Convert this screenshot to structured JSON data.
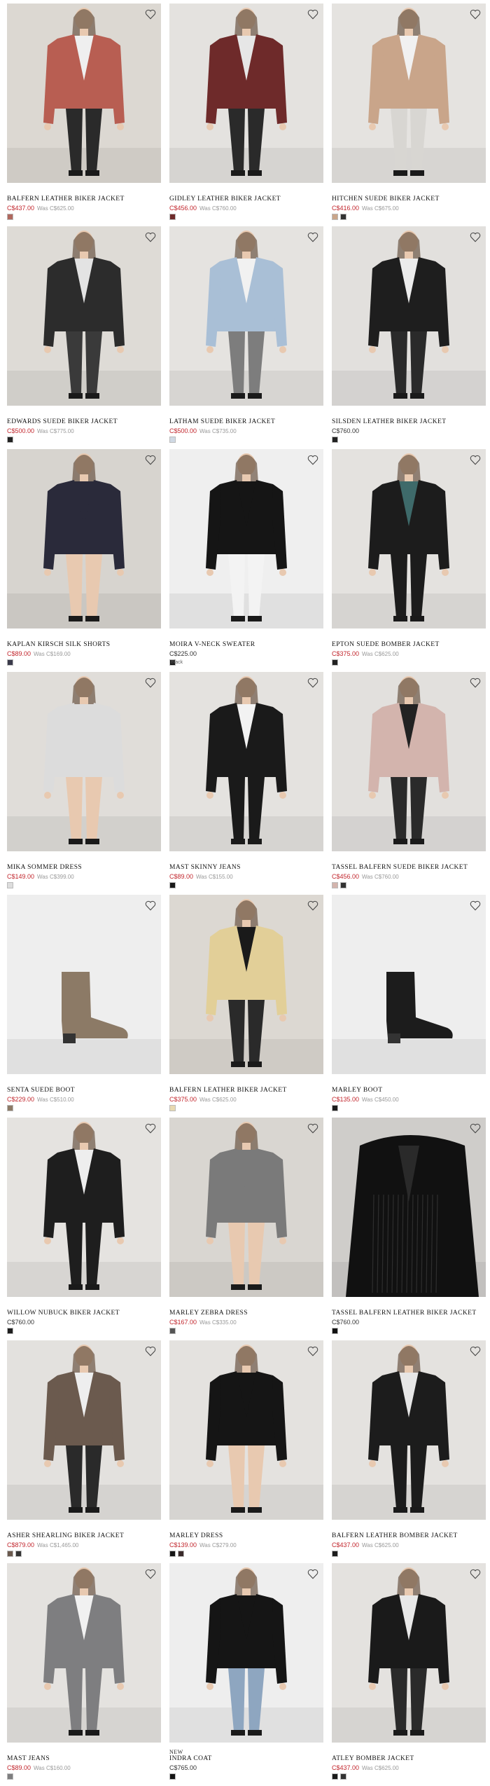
{
  "products": [
    {
      "name": "BALFERN LEATHER BIKER JACKET",
      "price": "C$437.00",
      "was": "Was C$625.00",
      "sale": true,
      "bg": "#dcd8d2",
      "garment": "#b85e52",
      "skin": "#e8c9b0",
      "pants": "#2a2a2a",
      "top": "#efefef",
      "swatches": [
        "#b0685e"
      ]
    },
    {
      "name": "GIDLEY LEATHER BIKER JACKET",
      "price": "C$456.00",
      "was": "Was C$760.00",
      "sale": true,
      "bg": "#e4e2df",
      "garment": "#6e2a2a",
      "skin": "#e8c9b0",
      "pants": "#2a2a2a",
      "top": "#e6e6e6",
      "swatches": [
        "#6e2a2a"
      ]
    },
    {
      "name": "HITCHEN SUEDE BIKER JACKET",
      "price": "C$416.00",
      "was": "Was C$675.00",
      "sale": true,
      "bg": "#e5e3e0",
      "garment": "#c9a58a",
      "skin": "#e8c9b0",
      "pants": "#d8d6d2",
      "top": "#f1f1f1",
      "swatches": [
        "#c9a58a",
        "#333333"
      ]
    },
    {
      "name": "EDWARDS SUEDE BIKER JACKET",
      "price": "C$500.00",
      "was": "Was C$775.00",
      "sale": true,
      "bg": "#dedbd6",
      "garment": "#2c2c2c",
      "skin": "#e8c9b0",
      "pants": "#3a3a3a",
      "top": "#e3e3e3",
      "swatches": [
        "#222222"
      ]
    },
    {
      "name": "LATHAM SUEDE BIKER JACKET",
      "price": "C$500.00",
      "was": "Was C$735.00",
      "sale": true,
      "bg": "#e5e3e0",
      "garment": "#a9bfd6",
      "skin": "#e8c9b0",
      "pants": "#7d7d7d",
      "top": "#f1f1f1",
      "swatches": [
        "#cfd9e4"
      ]
    },
    {
      "name": "SILSDEN LEATHER BIKER JACKET",
      "price": "C$760.00",
      "was": "",
      "sale": false,
      "bg": "#e2e0dd",
      "garment": "#1e1e1e",
      "skin": "#e8c9b0",
      "pants": "#2a2a2a",
      "top": "#ececec",
      "swatches": [
        "#222222"
      ]
    },
    {
      "name": "KAPLAN KIRSCH SILK SHORTS",
      "price": "C$89.00",
      "was": "Was C$169.00",
      "sale": true,
      "bg": "#d7d4cf",
      "garment": "#2a2a3a",
      "skin": "#e8c9b0",
      "pants": "#e8c9b0",
      "top": "#2a2a3a",
      "swatches": [
        "#3a3a4a"
      ]
    },
    {
      "name": "MOIRA V-NECK SWEATER",
      "price": "C$225.00",
      "was": "",
      "sale": false,
      "bg": "#efefef",
      "garment": "#151515",
      "skin": "#e8c9b0",
      "pants": "#f3f3f3",
      "top": "#151515",
      "swatches": [
        "#151515"
      ],
      "swatch_label": "Black"
    },
    {
      "name": "EPTON SUEDE BOMBER JACKET",
      "price": "C$375.00",
      "was": "Was C$625.00",
      "sale": true,
      "bg": "#e4e2df",
      "garment": "#1c1c1c",
      "skin": "#e8c9b0",
      "pants": "#1c1c1c",
      "top": "#3e6a6a",
      "swatches": [
        "#222222"
      ]
    },
    {
      "name": "MIKA SOMMER DRESS",
      "price": "C$149.00",
      "was": "Was C$399.00",
      "sale": true,
      "bg": "#e0ddd9",
      "garment": "#dcdcdc",
      "skin": "#e8c9b0",
      "pants": "#e8c9b0",
      "top": "#dcdcdc",
      "swatches": [
        "#dddddd"
      ]
    },
    {
      "name": "MAST SKINNY JEANS",
      "price": "C$89.00",
      "was": "Was C$155.00",
      "sale": true,
      "bg": "#e4e2df",
      "garment": "#1a1a1a",
      "skin": "#e8c9b0",
      "pants": "#1a1a1a",
      "top": "#f2f2f2",
      "swatches": [
        "#1a1a1a"
      ]
    },
    {
      "name": "TASSEL BALFERN SUEDE BIKER JACKET",
      "price": "C$456.00",
      "was": "Was C$760.00",
      "sale": true,
      "bg": "#e2e0dd",
      "garment": "#d3b4ad",
      "skin": "#e8c9b0",
      "pants": "#2a2a2a",
      "top": "#222222",
      "swatches": [
        "#d3b4ad",
        "#333333"
      ]
    },
    {
      "name": "SENTA SUEDE BOOT",
      "price": "C$229.00",
      "was": "Was C$510.00",
      "sale": true,
      "bg": "#eeeeee",
      "garment": "#8c7a66",
      "skin": "#8c7a66",
      "pants": "#eeeeee",
      "top": "#eeeeee",
      "swatches": [
        "#8c7a66"
      ],
      "item": "boot"
    },
    {
      "name": "BALFERN LEATHER BIKER JACKET",
      "price": "C$375.00",
      "was": "Was C$625.00",
      "sale": true,
      "bg": "#dcd8d2",
      "garment": "#e2cf98",
      "skin": "#e8c9b0",
      "pants": "#2a2a2a",
      "top": "#1a1a1a",
      "swatches": [
        "#e8d9b0"
      ]
    },
    {
      "name": "MARLEY BOOT",
      "price": "C$135.00",
      "was": "Was C$450.00",
      "sale": true,
      "bg": "#eeeeee",
      "garment": "#1c1c1c",
      "skin": "#1c1c1c",
      "pants": "#eeeeee",
      "top": "#eeeeee",
      "swatches": [
        "#1c1c1c"
      ],
      "item": "boot"
    },
    {
      "name": "WILLOW NUBUCK BIKER JACKET",
      "price": "C$760.00",
      "was": "",
      "sale": false,
      "bg": "#e5e3e0",
      "garment": "#1e1e1e",
      "skin": "#e8c9b0",
      "pants": "#1e1e1e",
      "top": "#eeeeee",
      "swatches": [
        "#1e1e1e"
      ]
    },
    {
      "name": "MARLEY ZEBRA DRESS",
      "price": "C$167.00",
      "was": "Was C$335.00",
      "sale": true,
      "bg": "#d9d6d1",
      "garment": "#7a7a7a",
      "skin": "#e8c9b0",
      "pants": "#e8c9b0",
      "top": "#7a7a7a",
      "swatches": [
        "#555555"
      ]
    },
    {
      "name": "TASSEL BALFERN LEATHER BIKER JACKET",
      "price": "C$760.00",
      "was": "",
      "sale": false,
      "bg": "#cfcdca",
      "garment": "#111111",
      "skin": "#e8c9b0",
      "pants": "#111111",
      "top": "#111111",
      "swatches": [
        "#111111"
      ],
      "item": "closeup"
    },
    {
      "name": "ASHER SHEARLING BIKER JACKET",
      "price": "C$879.00",
      "was": "Was C$1,465.00",
      "sale": true,
      "bg": "#e3e1de",
      "garment": "#6b5a4e",
      "skin": "#e8c9b0",
      "pants": "#2a2a2a",
      "top": "#eeeeee",
      "swatches": [
        "#6b5a4e",
        "#333333"
      ]
    },
    {
      "name": "MARLEY DRESS",
      "price": "C$139.00",
      "was": "Was C$279.00",
      "sale": true,
      "bg": "#e4e2df",
      "garment": "#151515",
      "skin": "#e8c9b0",
      "pants": "#e8c9b0",
      "top": "#151515",
      "swatches": [
        "#151515",
        "#3a2a2a"
      ]
    },
    {
      "name": "BALFERN LEATHER BOMBER JACKET",
      "price": "C$437.00",
      "was": "Was C$625.00",
      "sale": true,
      "bg": "#e4e2df",
      "garment": "#1c1c1c",
      "skin": "#e8c9b0",
      "pants": "#1c1c1c",
      "top": "#e6e6e6",
      "swatches": [
        "#1c1c1c"
      ]
    },
    {
      "name": "MAST JEANS",
      "price": "C$89.00",
      "was": "Was C$160.00",
      "sale": true,
      "bg": "#e4e2df",
      "garment": "#7e7e80",
      "skin": "#e8c9b0",
      "pants": "#7e7e80",
      "top": "#f1f1f1",
      "swatches": [
        "#7e7e80"
      ]
    },
    {
      "name": "INDRA COAT",
      "tag": "NEW",
      "price": "C$765.00",
      "was": "",
      "sale": false,
      "bg": "#eeeeee",
      "garment": "#151515",
      "skin": "#e8c9b0",
      "pants": "#8ea6c0",
      "top": "#151515",
      "swatches": [
        "#151515"
      ]
    },
    {
      "name": "ATLEY BOMBER JACKET",
      "price": "C$437.00",
      "was": "Was C$625.00",
      "sale": true,
      "bg": "#e4e2df",
      "garment": "#1a1a1a",
      "skin": "#e8c9b0",
      "pants": "#2a2a2a",
      "top": "#e8e8e8",
      "swatches": [
        "#1a1a1a",
        "#333333"
      ]
    }
  ]
}
